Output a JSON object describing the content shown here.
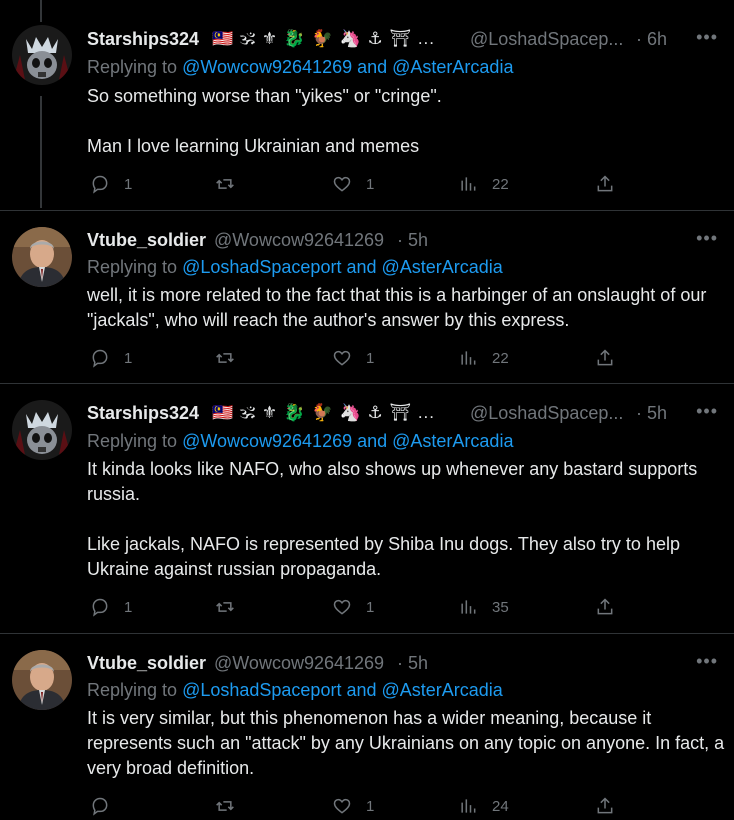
{
  "tweets": [
    {
      "name": "Starships324",
      "emojis": "🇲🇾 🕉 ⚜ 🐉 🐓 🦄 ⚓ ⛩ ...",
      "handle": "@LoshadSpacep...",
      "time": "· 6h",
      "reply_prefix": "Replying to ",
      "reply_to": "@Wowcow92641269 and @AsterArcadia",
      "paragraphs": [
        "So something worse than \"yikes\" or \"cringe\".",
        "Man I love learning Ukrainian and memes"
      ],
      "replies": "1",
      "retweets": "",
      "likes": "1",
      "views": "22"
    },
    {
      "name": "Vtube_soldier",
      "emojis": "",
      "handle": "@Wowcow92641269",
      "time": "· 5h",
      "reply_prefix": "Replying to ",
      "reply_to": "@LoshadSpaceport and @AsterArcadia",
      "paragraphs": [
        "well, it is more related to the fact that this is a harbinger of an onslaught of our \"jackals\", who will reach the author's answer by this express."
      ],
      "replies": "1",
      "retweets": "",
      "likes": "1",
      "views": "22"
    },
    {
      "name": "Starships324",
      "emojis": "🇲🇾 🕉 ⚜ 🐉 🐓 🦄 ⚓ ⛩ ...",
      "handle": "@LoshadSpacep...",
      "time": "· 5h",
      "reply_prefix": "Replying to ",
      "reply_to": "@Wowcow92641269 and @AsterArcadia",
      "paragraphs": [
        "It kinda looks like NAFO, who also shows up whenever any bastard supports russia.",
        "Like jackals, NAFO is represented by Shiba Inu dogs. They also try to help Ukraine against russian propaganda."
      ],
      "replies": "1",
      "retweets": "",
      "likes": "1",
      "views": "35"
    },
    {
      "name": "Vtube_soldier",
      "emojis": "",
      "handle": "@Wowcow92641269",
      "time": "· 5h",
      "reply_prefix": "Replying to ",
      "reply_to": "@LoshadSpaceport and @AsterArcadia",
      "paragraphs": [
        "It is very similar, but this phenomenon has a wider meaning, because it represents such an \"attack\" by any Ukrainians on any topic on anyone.  In fact, a very broad definition."
      ],
      "replies": "",
      "retweets": "",
      "likes": "1",
      "views": "24"
    }
  ],
  "more_label": "•••"
}
